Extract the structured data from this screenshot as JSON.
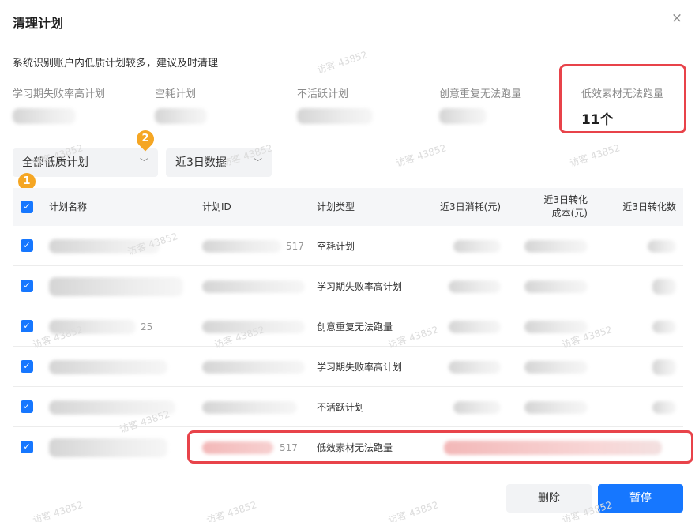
{
  "dialog": {
    "title": "清理计划",
    "close_glyph": "×",
    "description": "系统识别账户内低质计划较多，建议及时清理"
  },
  "stats": [
    {
      "label": "学习期失败率高计划",
      "value": ""
    },
    {
      "label": "空耗计划",
      "value": ""
    },
    {
      "label": "不活跃计划",
      "value": ""
    },
    {
      "label": "创意重复无法跑量",
      "value": ""
    },
    {
      "label": "低效素材无法跑量",
      "value": "11个"
    }
  ],
  "filters": {
    "plan_filter": "全部低质计划",
    "date_filter": "近3日数据"
  },
  "markers": {
    "one": "1",
    "two": "2"
  },
  "table": {
    "headers": {
      "name": "计划名称",
      "id": "计划ID",
      "type": "计划类型",
      "cost": "近3日消耗(元)",
      "conv_cost_line1": "近3日转化",
      "conv_cost_line2": "成本(元)",
      "conv_count": "近3日转化数"
    },
    "rows": [
      {
        "name_tail": "",
        "id_tail": "517",
        "type": "空耗计划",
        "checked": true
      },
      {
        "name_tail": "",
        "id_tail": "",
        "type": "学习期失败率高计划",
        "checked": true
      },
      {
        "name_tail": "25",
        "id_tail": "",
        "type": "创意重复无法跑量",
        "checked": true
      },
      {
        "name_tail": "",
        "id_tail": "",
        "type": "学习期失败率高计划",
        "checked": true
      },
      {
        "name_tail": "",
        "id_tail": "",
        "type": "不活跃计划",
        "checked": true
      },
      {
        "name_tail": "",
        "id_tail": "517",
        "type": "低效素材无法跑量",
        "checked": true
      }
    ],
    "check_glyph": "✓"
  },
  "actions": {
    "delete_label": "删除",
    "pause_label": "暂停"
  },
  "watermark_text": "访客 43852",
  "colors": {
    "primary": "#1677ff",
    "highlight": "#e8434a",
    "marker": "#f5a623"
  }
}
